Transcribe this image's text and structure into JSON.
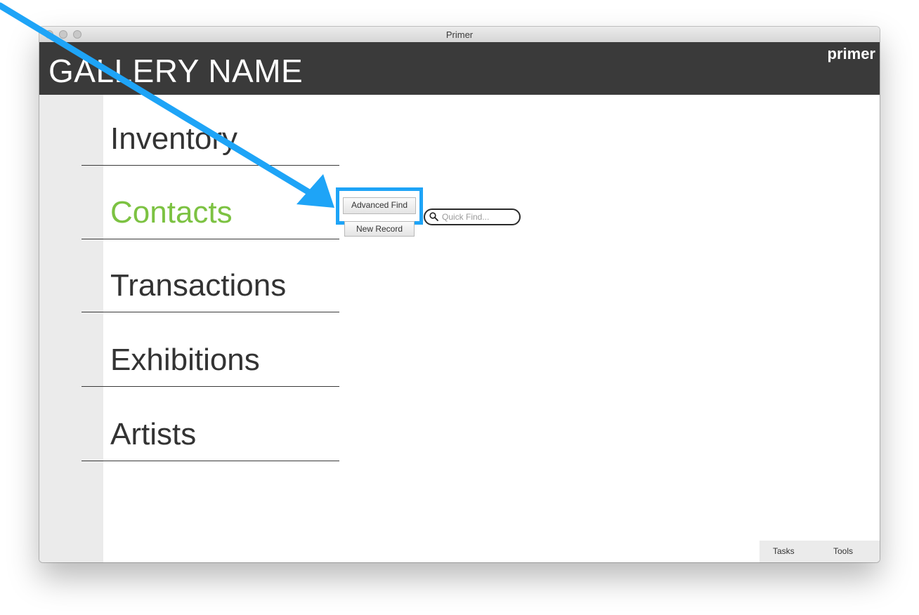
{
  "window": {
    "title": "Primer"
  },
  "header": {
    "gallery_name": "GALLERY NAME",
    "brand": "primer"
  },
  "nav": {
    "items": [
      {
        "label": "Inventory",
        "active": false
      },
      {
        "label": "Contacts",
        "active": true
      },
      {
        "label": "Transactions",
        "active": false
      },
      {
        "label": "Exhibitions",
        "active": false
      },
      {
        "label": "Artists",
        "active": false
      }
    ]
  },
  "toolbar": {
    "advanced_find_label": "Advanced Find",
    "new_record_label": "New Record",
    "quick_find_placeholder": "Quick Find..."
  },
  "footer": {
    "tasks_label": "Tasks",
    "tools_label": "Tools"
  },
  "colors": {
    "accent_active": "#7cc242",
    "header_bg": "#3a3a3a",
    "annotation": "#1ea4f7"
  },
  "icons": {
    "search": "search-icon"
  }
}
